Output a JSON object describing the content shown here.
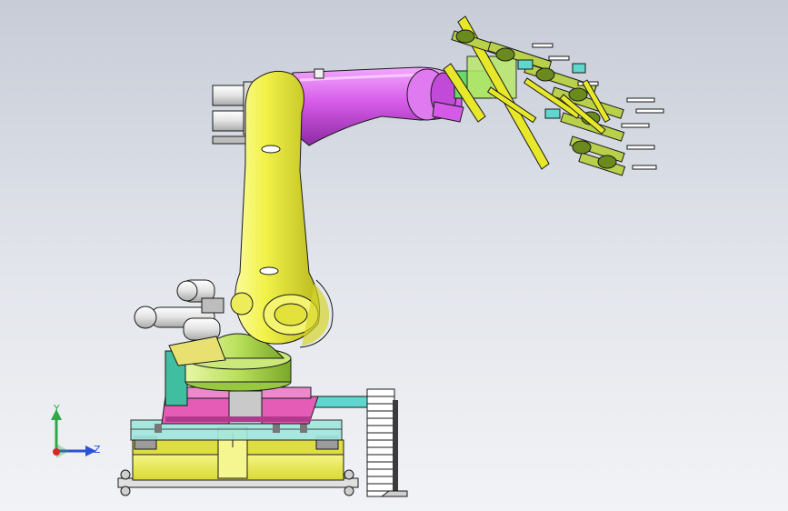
{
  "viewport": {
    "background_top": "#c7ccd7",
    "background_bottom": "#f2f3f6"
  },
  "model": {
    "part_colors": {
      "arm": "#f2f24a",
      "arm_shade": "#c9c92c",
      "forearm": "#d65ae8",
      "forearm_shade": "#a734c0",
      "base_plate": "#e9e94e",
      "turntable": "#b9e05a",
      "pedestal": "#e45cb6",
      "rail": "#5fd7cf",
      "gripper": "#b8d04a",
      "motor": "#e8e8e8",
      "outline": "#1a1a1a"
    },
    "icons": [
      "robot-arm-model",
      "gripper-end-effector",
      "cable-chain"
    ]
  },
  "triad": {
    "y_label": "Y",
    "z_label": "Z",
    "y_color": "#2fa84a",
    "z_color": "#2a52d6",
    "x_color": "#d62828"
  }
}
